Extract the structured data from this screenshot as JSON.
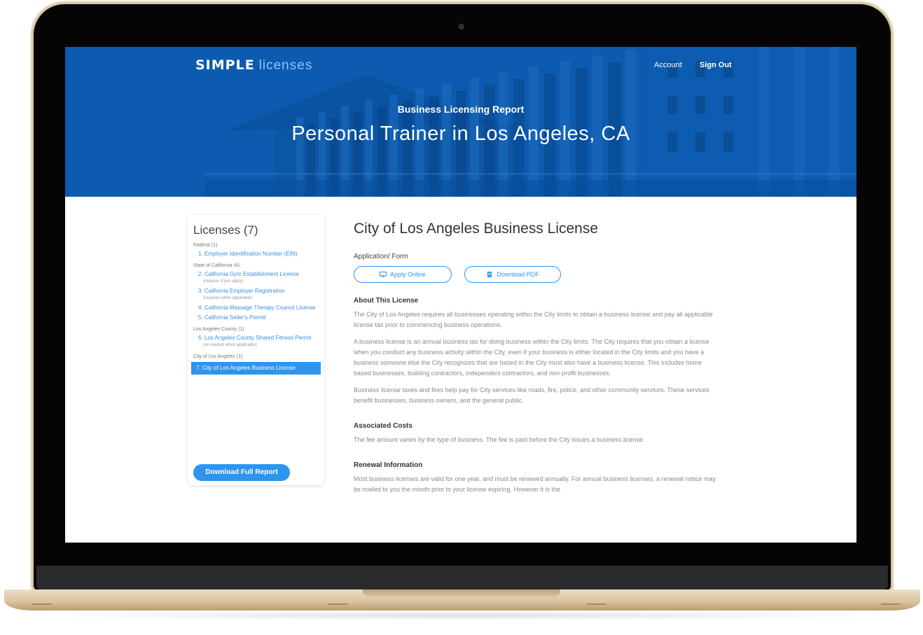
{
  "header": {
    "logo_bold": "SIMPLE",
    "logo_light": "licenses",
    "nav_account": "Account",
    "nav_signout": "Sign Out",
    "subtitle": "Business Licensing Report",
    "title": "Personal Trainer in Los Angeles, CA"
  },
  "sidebar": {
    "title": "Licenses (7)",
    "groups": [
      {
        "label": "Federal (1)"
      },
      {
        "label": "State of California (4)"
      },
      {
        "label": "Los Angeles County (1)"
      },
      {
        "label": "City of Los Angeles (1)"
      }
    ],
    "items": [
      {
        "label": "1. Employer Identification Number (EIN)"
      },
      {
        "label": "2. California Gym Establishment License",
        "note": "(requires if you apply)"
      },
      {
        "label": "3. California Employer Registration",
        "note": "(requires when applicable)"
      },
      {
        "label": "4. California Massage Therapy Council License"
      },
      {
        "label": "5. California Seller's Permit"
      },
      {
        "label": "6. Los Angeles County Shared Fitness Permit",
        "note": "(as needed when applicable)"
      },
      {
        "label": "7. City of Los Angeles Business License"
      }
    ],
    "download_label": "Download Full Report"
  },
  "main": {
    "title": "City of Los Angeles Business License",
    "app_label": "Application/ Form",
    "apply_label": "Apply Online",
    "pdf_label": "Download PDF",
    "about_heading": "About This License",
    "about_p1": "The City of Los Angeles requires all businesses operating within the City limits to obtain a business license and pay all applicable license tax prior to commencing business operations.",
    "about_p2": "A business license is an annual business tax for doing business within the City limits. The City requires that you obtain a license when you conduct any business activity within the City, even if your business is either located in the City limits and you have a business someone else the City recognizes that are based in the City must also have a business license. This includes home based businesses, building contractors, independent contractors, and non-profit businesses.",
    "about_p3": "Business license taxes and fees help pay for City services like roads, fire, police, and other community services. These services benefit businesses, business owners, and the general public.",
    "costs_heading": "Associated Costs",
    "costs_p": "The fee amount varies by the type of business. The fee is paid before the City issues a business license.",
    "renewal_heading": "Renewal Information",
    "renewal_p": "Most business licenses are valid for one year, and must be renewed annually. For annual business licenses, a renewal notice may be mailed to you the month prior to your license expiring. However it is the"
  },
  "icons": {
    "apply": "monitor-icon",
    "pdf": "document-icon",
    "camera": "camera-icon"
  },
  "colors": {
    "hero_blue": "#0d5bb0",
    "accent": "#2e95ec",
    "link": "#3a8fe0",
    "laptop_gold": "#d9c29c"
  }
}
